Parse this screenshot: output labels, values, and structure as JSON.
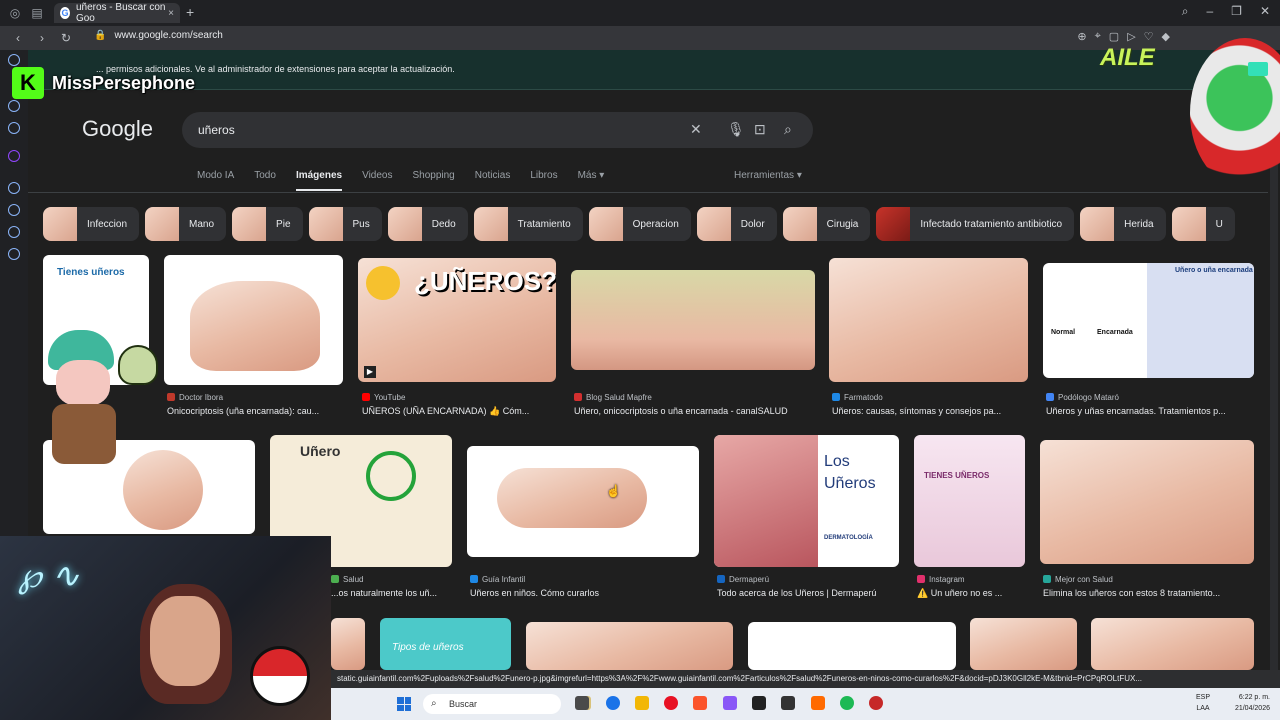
{
  "browser": {
    "tab_title": "uñeros - Buscar con Goo",
    "url": "www.google.com/search",
    "info_bar": "... permisos adicionales. Ve al administrador de extensiones para aceptar la actualización."
  },
  "stream": {
    "name": "MissPersephone",
    "badge_letter": "K",
    "overlay_text": "AILE"
  },
  "google": {
    "logo": "Google",
    "query": "uñeros",
    "tabs": [
      "Modo IA",
      "Todo",
      "Imágenes",
      "Videos",
      "Shopping",
      "Noticias",
      "Libros",
      "Más"
    ],
    "active_tab": "Imágenes",
    "tools": "Herramientas",
    "chips": [
      "Infeccion",
      "Mano",
      "Pie",
      "Pus",
      "Dedo",
      "Tratamiento",
      "Operacion",
      "Dolor",
      "Cirugia",
      "Infectado tratamiento antibiotico",
      "Herida",
      "U"
    ]
  },
  "results_row1": [
    {
      "source": "Doctor Ibora",
      "title": "Onicocriptosis (uña encarnada): cau..."
    },
    {
      "source": "YouTube",
      "title": "UÑEROS (UÑA ENCARNADA) 👍 Cóm...",
      "overlay": "¿UÑEROS?"
    },
    {
      "source": "Blog Salud Mapfre",
      "title": "Uñero, onicocriptosis o uña encarnada - canalSALUD"
    },
    {
      "source": "Farmatodo",
      "title": "Uñeros: causas, síntomas y consejos pa..."
    },
    {
      "source": "Podólogo Mataró",
      "title": "Uñeros y uñas encarnadas. Tratamientos p...",
      "overlay": "Uñero o uña encarnada",
      "labels": [
        "Normal",
        "Encarnada"
      ]
    }
  ],
  "results_row2": [
    {
      "source": "Salud",
      "title": "...os naturalmente los uñ...",
      "overlay": "Uñero"
    },
    {
      "source": "Guía Infantil",
      "title": "Uñeros en niños. Cómo curarlos"
    },
    {
      "source": "Dermaperú",
      "title": "Todo acerca de los Uñeros | Dermaperú",
      "overlay": "Los Uñeros",
      "footer": "DERMATOLOGÍA"
    },
    {
      "source": "Instagram",
      "title": "⚠️ Un uñero no es ...",
      "overlay": "TIENES UÑEROS"
    },
    {
      "source": "Mejor con Salud",
      "title": "Elimina los uñeros con estos 8 tratamiento..."
    }
  ],
  "first_image_text": "Tienes uñeros",
  "row3_text": "Tipos de uñeros",
  "status_url": "static.guiainfantil.com%2Fuploads%2Fsalud%2Funero-p.jpg&imgrefurl=https%3A%2F%2Fwww.guiainfantil.com%2Farticulos%2Fsalud%2Funeros-en-ninos-como-curarlos%2F&docid=pDJ3K0Gll2kE-M&tbnid=PrCPqROLtFUX...",
  "taskbar": {
    "search": "Buscar",
    "lang": "ESP",
    "lang2": "LAA",
    "time": "6:22 p. m.",
    "date": "21/04/2026"
  },
  "colors": {
    "background": "#1f1f1f",
    "searchbox": "#303134",
    "accent": "#8ab4f8",
    "kick": "#53fc18"
  }
}
